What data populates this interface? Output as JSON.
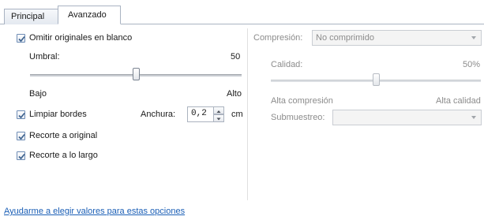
{
  "tabs": [
    {
      "label": "Principal",
      "active": false
    },
    {
      "label": "Avanzado",
      "active": true
    }
  ],
  "left": {
    "omit_blank": {
      "label": "Omitir originales en blanco",
      "checked": true
    },
    "threshold": {
      "label": "Umbral:",
      "value": "50",
      "slider_fraction": 0.5
    },
    "range_low": "Bajo",
    "range_high": "Alto",
    "clean_edges": {
      "label": "Limpiar bordes",
      "checked": true
    },
    "width": {
      "label": "Anchura:",
      "value": "0,2",
      "unit": "cm"
    },
    "crop_original": {
      "label": "Recorte a original",
      "checked": true
    },
    "crop_length": {
      "label": "Recorte a lo largo",
      "checked": true
    }
  },
  "right": {
    "compression": {
      "label": "Compresión:",
      "value": "No comprimido"
    },
    "quality": {
      "label": "Calidad:",
      "value": "50%",
      "slider_fraction": 0.5
    },
    "range_low": "Alta compresión",
    "range_high": "Alta calidad",
    "subsampling": {
      "label": "Submuestreo:",
      "value": ""
    }
  },
  "help_link": "Ayudarme a elegir valores para estas opciones",
  "colors": {
    "link": "#1b5fb6",
    "check": "#3a5f8c",
    "disabled_text": "#8c8c8c"
  }
}
